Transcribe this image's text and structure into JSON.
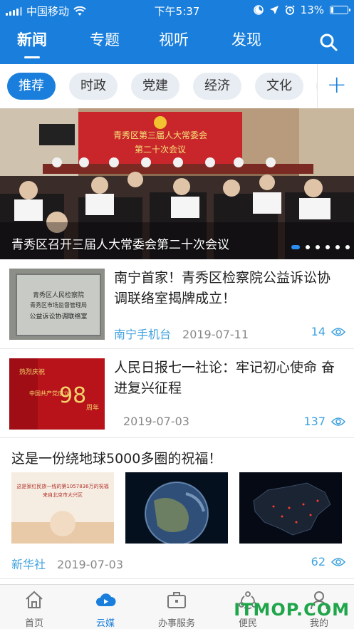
{
  "status": {
    "carrier": "中国移动",
    "time": "下午5:37",
    "battery": "13%",
    "battery_level": 0.13
  },
  "header": {
    "tabs": [
      {
        "label": "新闻",
        "active": true
      },
      {
        "label": "专题",
        "active": false
      },
      {
        "label": "视听",
        "active": false
      },
      {
        "label": "发现",
        "active": false
      }
    ],
    "search_icon": "search-icon",
    "accent": "#1a7fdc"
  },
  "categories": {
    "items": [
      "推荐",
      "时政",
      "党建",
      "经济",
      "文化"
    ],
    "active_index": 0,
    "add_icon": "plus-icon"
  },
  "banner": {
    "caption": "青秀区召开三届人大常委会第二十次会议",
    "sign_line1": "青秀区第三届人大常委会",
    "sign_line2": "第二十次会议",
    "slide_count": 6,
    "active_slide": 0
  },
  "news": [
    {
      "title": "南宁首家！青秀区检察院公益诉讼协调联络室揭牌成立！",
      "source": "南宁手机台",
      "date": "2019-07-11",
      "views": "14",
      "thumb_text": [
        "青秀区人民检察院",
        "青秀区市场监督管理局",
        "公益诉讼协调联络室"
      ]
    },
    {
      "title": "人民日报七一社论：牢记初心使命 奋进复兴征程",
      "source": "",
      "date": "2019-07-03",
      "views": "137",
      "thumb_text": [
        "热烈庆祝",
        "中国共产党成立",
        "98",
        "周年"
      ]
    }
  ],
  "triple": {
    "title": "这是一份绕地球5000多圈的祝福！",
    "source": "新华社",
    "date": "2019-07-03",
    "views": "62",
    "img1_text": [
      "这是家红民族一线的第1057836万的祝福",
      "来自北京市大兴区"
    ]
  },
  "bottom_nav": [
    {
      "label": "首页",
      "icon": "home-icon",
      "active": false
    },
    {
      "label": "云媒",
      "icon": "cloud-icon",
      "active": true
    },
    {
      "label": "办事服务",
      "icon": "briefcase-icon",
      "active": false
    },
    {
      "label": "便民",
      "icon": "people-icon",
      "active": false
    },
    {
      "label": "我的",
      "icon": "user-icon",
      "active": false
    }
  ],
  "watermark": "ITMOP.COM"
}
